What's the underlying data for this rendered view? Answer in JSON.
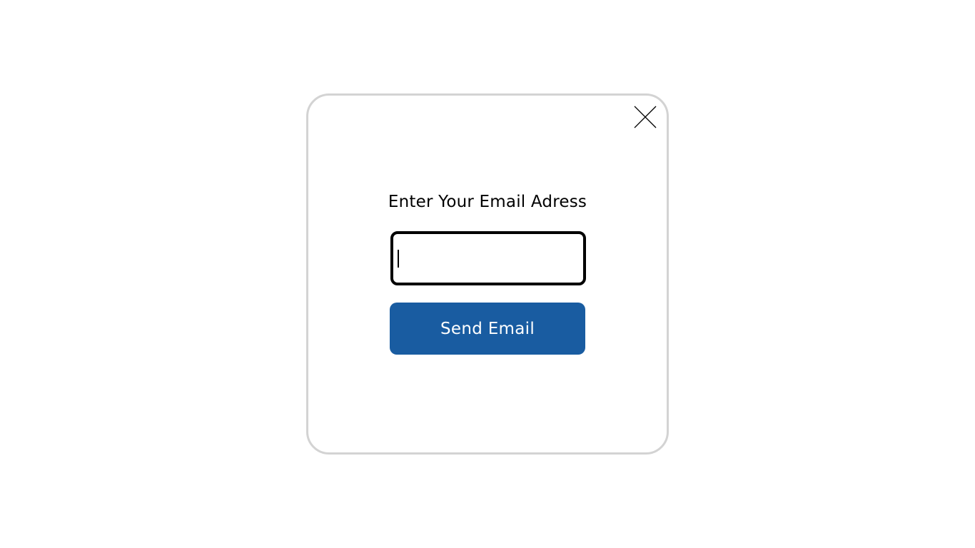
{
  "modal": {
    "title": "Enter Your Email Adress",
    "close_icon": "close-icon",
    "email_input": {
      "value": "",
      "placeholder": ""
    },
    "send_button_label": "Send Email"
  },
  "colors": {
    "modal_border": "#d3d3d3",
    "input_border": "#000000",
    "button_background": "#195ca1",
    "button_text": "#ffffff",
    "text": "#000000"
  }
}
